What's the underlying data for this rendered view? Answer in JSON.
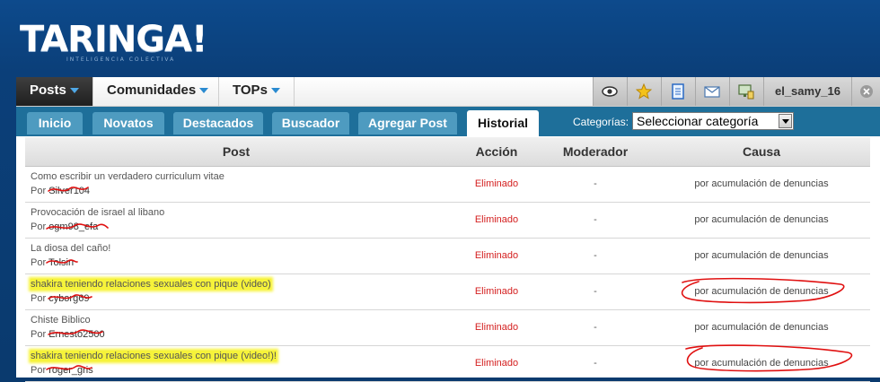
{
  "logo": {
    "word": "TARINGA!",
    "tagline": "INTELIGENCIA COLECTIVA"
  },
  "topnav": {
    "items": [
      {
        "label": "Posts"
      },
      {
        "label": "Comunidades"
      },
      {
        "label": "TOPs"
      }
    ],
    "username": "el_samy_16",
    "icons": [
      "eye-icon",
      "star-icon",
      "document-icon",
      "mail-icon",
      "monitor-icon",
      "close-icon"
    ]
  },
  "subnav": {
    "tabs": [
      {
        "label": "Inicio"
      },
      {
        "label": "Novatos"
      },
      {
        "label": "Destacados"
      },
      {
        "label": "Buscador"
      },
      {
        "label": "Agregar Post"
      },
      {
        "label": "Historial"
      }
    ],
    "active_tab": "Historial",
    "categories_label": "Categorías:",
    "category_selected": "Seleccionar categoría"
  },
  "table": {
    "headers": {
      "post": "Post",
      "accion": "Acción",
      "moderador": "Moderador",
      "causa": "Causa"
    },
    "rows": [
      {
        "title": "Como escribir un verdadero curriculum vitae",
        "by": "Por",
        "user": "Silver104",
        "action": "Eliminado",
        "moderator": "-",
        "cause": "por acumulación de denuncias"
      },
      {
        "title": "Provocación de israel al libano",
        "by": "Por",
        "user": "ogm98_efa",
        "action": "Eliminado",
        "moderator": "-",
        "cause": "por acumulación de denuncias"
      },
      {
        "title": "La diosa del caño!",
        "by": "Por",
        "user": "Tolsin",
        "action": "Eliminado",
        "moderator": "-",
        "cause": "por acumulación de denuncias"
      },
      {
        "title": "shakira teniendo relaciones sexuales con pique (video)",
        "by": "Por",
        "user": "cyborg69",
        "action": "Eliminado",
        "moderator": "-",
        "cause": "por acumulación de denuncias"
      },
      {
        "title": "Chiste Biblico",
        "by": "Por",
        "user": "Ernesto2500",
        "action": "Eliminado",
        "moderator": "-",
        "cause": "por acumulación de denuncias"
      },
      {
        "title": "shakira teniendo relaciones sexuales con pique (video!)!",
        "by": "Por",
        "user": "roger_gris",
        "action": "Eliminado",
        "moderator": "-",
        "cause": "por acumulación de denuncias"
      }
    ]
  }
}
